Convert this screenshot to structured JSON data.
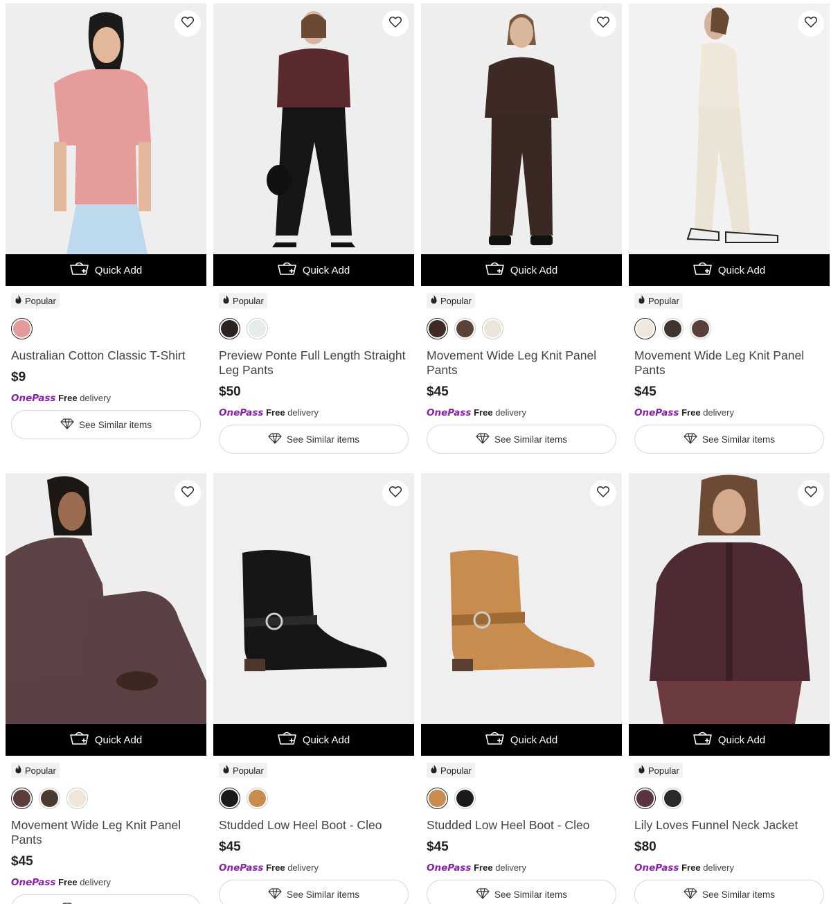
{
  "quick_add_label": "Quick Add",
  "popular_label": "Popular",
  "onepass": {
    "brand": "OnePass",
    "free": "Free",
    "delivery": "delivery"
  },
  "see_similar_label": "See Similar items",
  "products": [
    {
      "title": "Australian Cotton Classic T-Shirt",
      "price": "$9",
      "swatch_colors": [
        "#e39a9a"
      ]
    },
    {
      "title": "Preview Ponte Full Length Straight Leg Pants",
      "price": "$50",
      "swatch_colors": [
        "#2b2320",
        "#e6ece6"
      ]
    },
    {
      "title": "Movement Wide Leg Knit Panel Pants",
      "price": "$45",
      "swatch_colors": [
        "#3f2b24",
        "#5a4238",
        "#ece6da"
      ]
    },
    {
      "title": "Movement Wide Leg Knit Panel Pants",
      "price": "$45",
      "swatch_colors": [
        "#efe9dc",
        "#3f3430",
        "#5b3f38"
      ]
    },
    {
      "title": "Movement Wide Leg Knit Panel Pants",
      "price": "$45",
      "swatch_colors": [
        "#5a3f3c",
        "#4a3a30",
        "#eee6d6"
      ]
    },
    {
      "title": "Studded Low Heel Boot - Cleo",
      "price": "$45",
      "swatch_colors": [
        "#1b1b1b",
        "#c88d4e"
      ]
    },
    {
      "title": "Studded Low Heel Boot - Cleo",
      "price": "$45",
      "swatch_colors": [
        "#c88d4e",
        "#1b1b1b"
      ]
    },
    {
      "title": "Lily Loves Funnel Neck Jacket",
      "price": "$80",
      "swatch_colors": [
        "#5a3440",
        "#2a2a28"
      ]
    }
  ],
  "colors": {
    "quick_add_bg": "#000000",
    "onepass_purple": "#8a1fb0",
    "badge_bg": "#f2f2f2"
  }
}
